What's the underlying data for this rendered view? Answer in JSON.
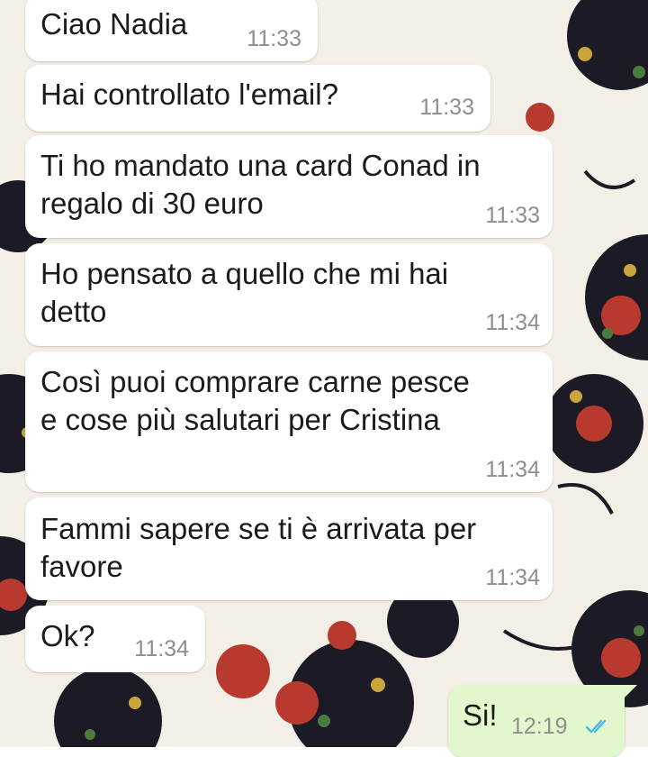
{
  "conversation": {
    "messages": [
      {
        "text": "Ciao Nadia",
        "time": "11:33",
        "direction": "incoming"
      },
      {
        "text": "Hai controllato l'email?",
        "time": "11:33",
        "direction": "incoming"
      },
      {
        "text": "Ti ho mandato una card Conad in",
        "text2": "regalo di 30 euro",
        "time": "11:33",
        "direction": "incoming"
      },
      {
        "text": "Ho pensato a quello che mi hai",
        "text2": "detto",
        "time": "11:34",
        "direction": "incoming"
      },
      {
        "text": "Così puoi comprare carne pesce",
        "text2": "e cose più salutari per Cristina",
        "time": "11:34",
        "direction": "incoming"
      },
      {
        "text": "Fammi sapere se ti è arrivata per",
        "text2": "favore",
        "time": "11:34",
        "direction": "incoming"
      },
      {
        "text": "Ok?",
        "time": "11:34",
        "direction": "incoming"
      },
      {
        "text": "Si!",
        "time": "12:19",
        "direction": "outgoing",
        "status": "read"
      }
    ]
  },
  "colors": {
    "incoming_bubble": "#ffffff",
    "outgoing_bubble": "#e2f7cb",
    "read_ticks": "#4fb6ec",
    "timestamp": "#8e8e8e"
  },
  "icons": {
    "read_receipt": "double-check-icon"
  }
}
